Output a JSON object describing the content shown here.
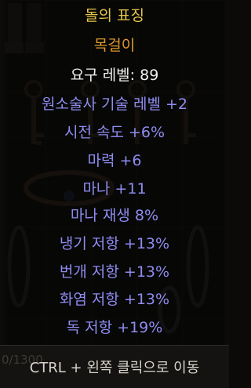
{
  "tooltip": {
    "item_name": "돌의 표징",
    "item_type": "목걸이",
    "required_level": "요구 레벨: 89",
    "mods": [
      "원소술사 기술 레벨 +2",
      "시전 속도 +6%",
      "마력 +6",
      "마나 +11",
      "마나 재생 8%",
      "냉기 저항 +13%",
      "번개 저항 +13%",
      "화염 저항 +13%",
      "독 저항 +19%"
    ]
  },
  "footer": {
    "counter": "0/1300",
    "hint": "CTRL + 왼쪽 클릭으로 이동"
  },
  "colors": {
    "name": "#e6c64a",
    "type": "#e09a2e",
    "requirement": "#f0f0f0",
    "magic_mod": "#8f8cf0"
  }
}
